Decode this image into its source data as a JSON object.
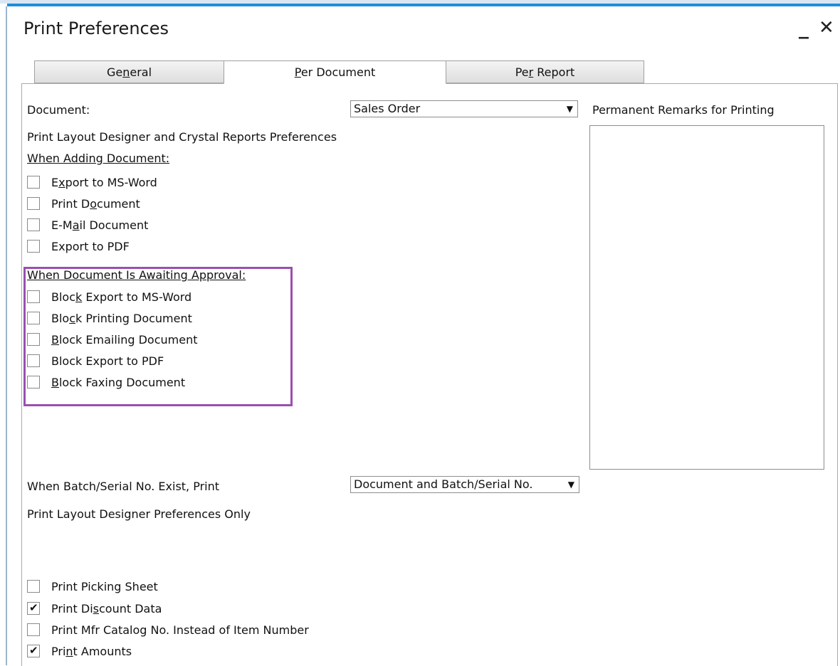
{
  "window": {
    "title": "Print Preferences",
    "minimize_glyph": "_",
    "close_glyph": "✕"
  },
  "tabs": [
    {
      "label_pre": "Ge",
      "label_key": "n",
      "label_post": "eral",
      "active": false
    },
    {
      "label_pre": "",
      "label_key": "P",
      "label_post": "er Document",
      "active": true
    },
    {
      "label_pre": "Pe",
      "label_key": "r",
      "label_post": " Report",
      "active": false
    }
  ],
  "document": {
    "label": "Document:",
    "selected": "Sales Order"
  },
  "remarks": {
    "label": "Permanent Remarks for Printing",
    "value": ""
  },
  "crystal_prefs_label": "Print Layout Designer and Crystal Reports Preferences",
  "when_adding": {
    "heading": "When Adding Document:",
    "options": [
      {
        "pre": "E",
        "key": "x",
        "post": "port to MS-Word",
        "checked": false
      },
      {
        "pre": "Print D",
        "key": "o",
        "post": "cument",
        "checked": false
      },
      {
        "pre": "E-M",
        "key": "a",
        "post": "il Document",
        "checked": false
      },
      {
        "pre": "Export to PDF",
        "key": "",
        "post": "",
        "checked": false
      }
    ]
  },
  "awaiting_approval": {
    "heading": "When Document Is Awaiting Approval:",
    "options": [
      {
        "pre": "Bloc",
        "key": "k",
        "post": " Export to MS-Word",
        "checked": false
      },
      {
        "pre": "Blo",
        "key": "c",
        "post": "k Printing Document",
        "checked": false
      },
      {
        "pre": "",
        "key": "B",
        "post": "lock Emailing Document",
        "checked": false
      },
      {
        "pre": "Block Export to PDF",
        "key": "",
        "post": "",
        "checked": false
      },
      {
        "pre": "",
        "key": "B",
        "post": "lock Faxing Document",
        "checked": false
      }
    ]
  },
  "batch_serial": {
    "label": "When Batch/Serial No. Exist, Print",
    "selected": "Document and Batch/Serial No."
  },
  "pld_only_label": "Print Layout Designer Preferences Only",
  "pld_options": [
    {
      "pre": "Print Picking Sheet",
      "key": "",
      "post": "",
      "checked": false
    },
    {
      "pre": "Print Di",
      "key": "s",
      "post": "count Data",
      "checked": true
    },
    {
      "pre": "Print Mfr Catalog No. Instead of Item Number",
      "key": "",
      "post": "",
      "checked": false
    },
    {
      "pre": "Pri",
      "key": "n",
      "post": "t Amounts",
      "checked": true
    }
  ],
  "colors": {
    "accent": "#1e8fd6",
    "highlight": "#9b4fb0"
  }
}
